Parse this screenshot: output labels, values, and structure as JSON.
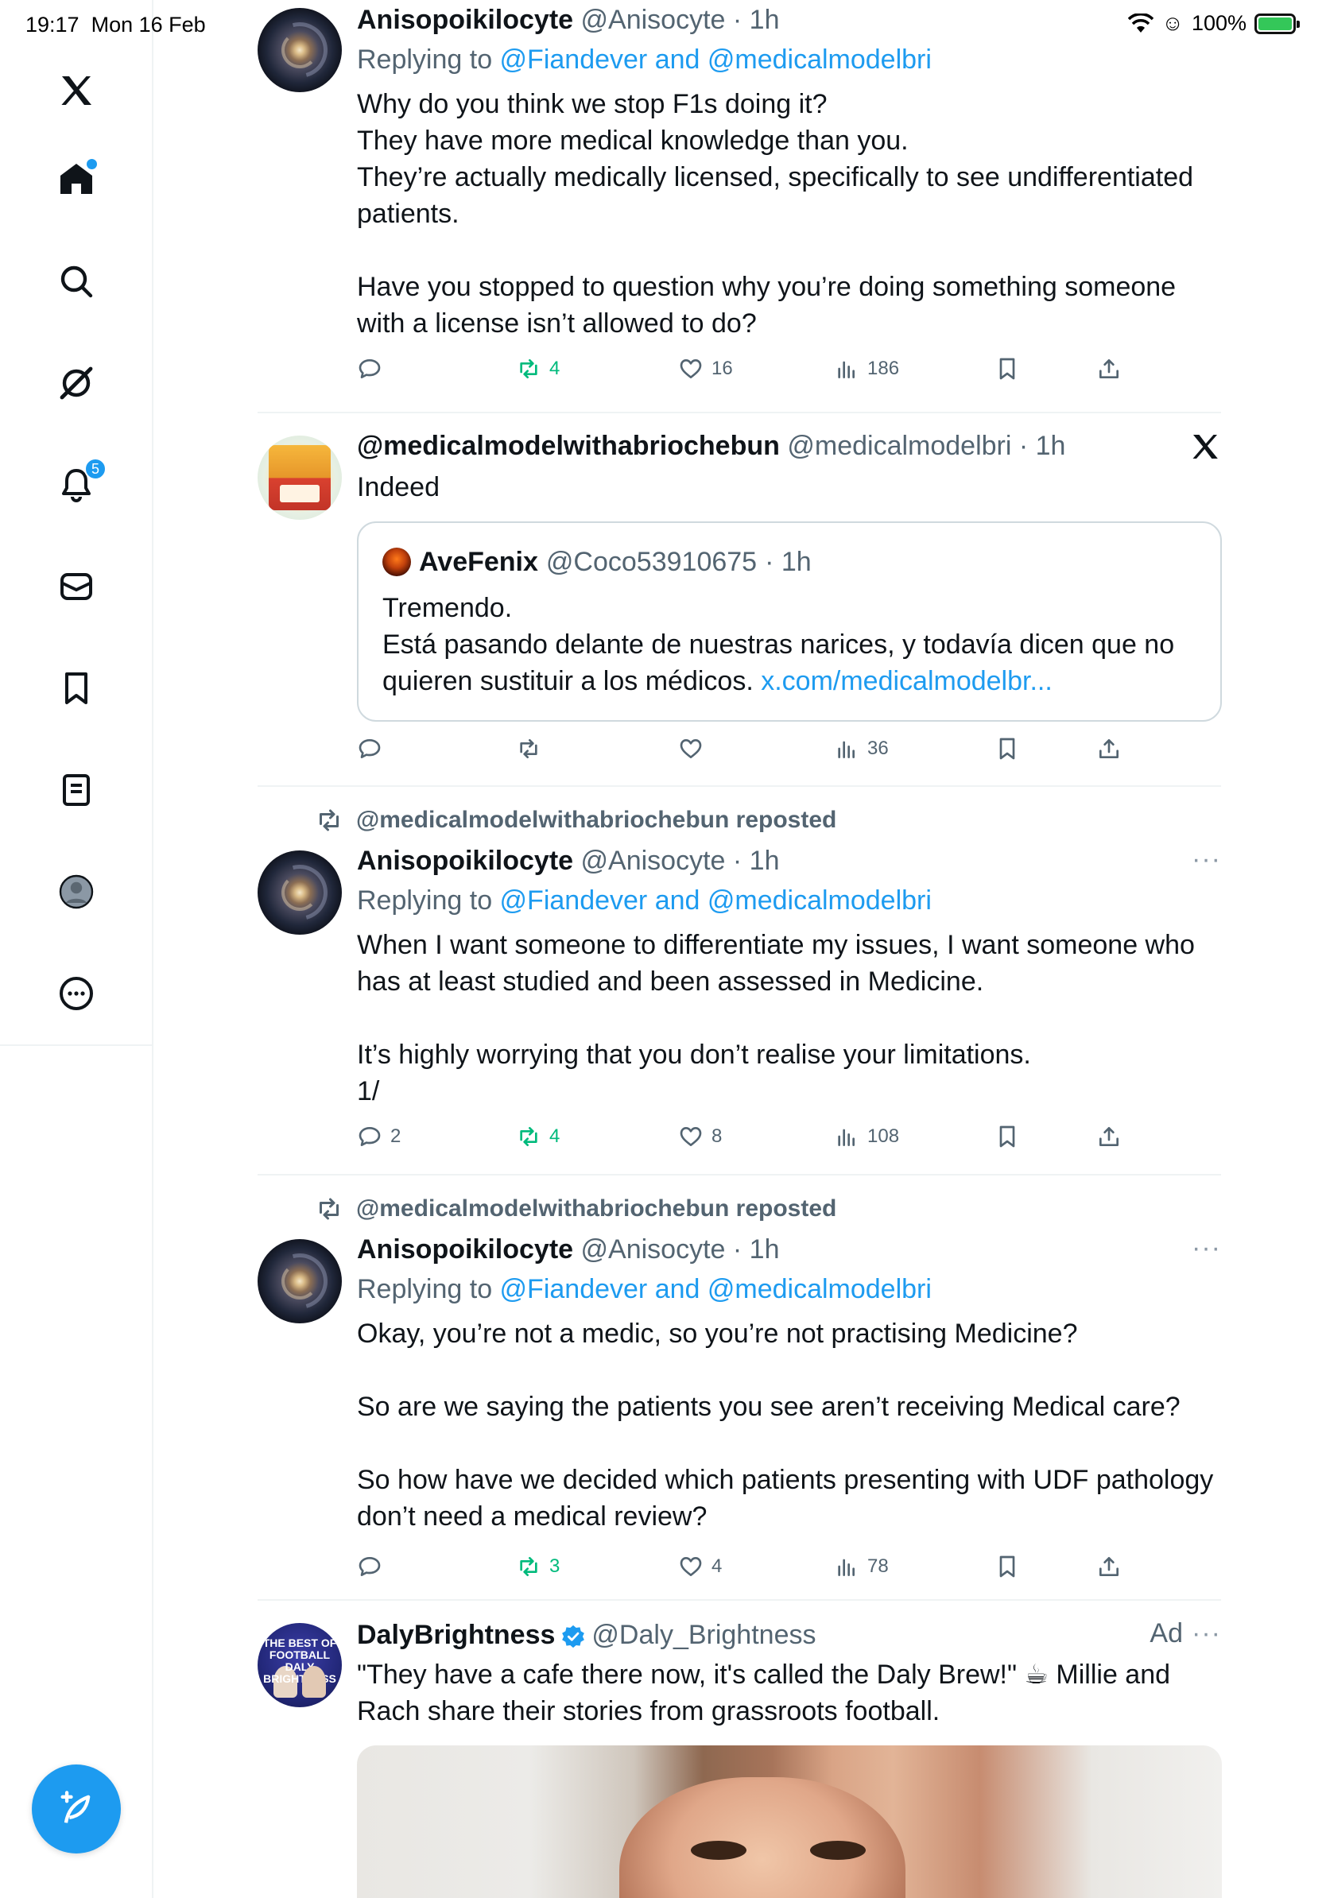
{
  "status_bar": {
    "time": "19:17",
    "date": "Mon 16 Feb",
    "battery": "100%"
  },
  "sidebar": {
    "notifications_badge": "5"
  },
  "tweets": [
    {
      "name": "Anisopoikilocyte",
      "handle": "@Anisocyte",
      "time": "· 1h",
      "replying_prefix": "Replying to ",
      "replying_to": "@Fiandever and @medicalmodelbri",
      "text": "Why do you think we stop F1s doing it?\nThey have more medical knowledge than you.\nThey’re actually medically licensed, specifically to see undifferentiated patients.\n\nHave you stopped to question why you’re doing something someone with a license isn’t allowed to do?",
      "replies": "",
      "reposts": "4",
      "likes": "16",
      "views": "186"
    },
    {
      "name": "@medicalmodelwithabriochebun",
      "handle": "@medicalmodelbri",
      "time": "· 1h",
      "text": "Indeed",
      "quote": {
        "name": "AveFenix",
        "handle": "@Coco53910675",
        "time": "· 1h",
        "text": "Tremendo.\nEstá pasando delante de nuestras narices, y todavía dicen que no quieren sustituir a los médicos. ",
        "link": "x.com/medicalmodelbr..."
      },
      "replies": "",
      "reposts": "",
      "likes": "",
      "views": "36"
    },
    {
      "repost_label": "@medicalmodelwithabriochebun reposted",
      "name": "Anisopoikilocyte",
      "handle": "@Anisocyte",
      "time": "· 1h",
      "replying_prefix": "Replying to ",
      "replying_to": "@Fiandever and @medicalmodelbri",
      "text": "When I want someone to differentiate my issues, I want someone who has at least studied and been assessed in Medicine.\n\nIt’s highly worrying that you don’t realise your limitations.\n1/",
      "replies": "2",
      "reposts": "4",
      "likes": "8",
      "views": "108"
    },
    {
      "repost_label": "@medicalmodelwithabriochebun reposted",
      "name": "Anisopoikilocyte",
      "handle": "@Anisocyte",
      "time": "· 1h",
      "replying_prefix": "Replying to ",
      "replying_to": "@Fiandever and @medicalmodelbri",
      "text": "Okay, you’re not a medic, so you’re not practising Medicine?\n\nSo are we saying the patients you see aren’t receiving Medical care?\n\nSo how have we decided which patients presenting with UDF pathology don’t need a medical review?",
      "replies": "",
      "reposts": "3",
      "likes": "4",
      "views": "78"
    },
    {
      "name": "DalyBrightness",
      "handle": "@Daly_Brightness",
      "ad_label": "Ad",
      "avatar_text": "THE BEST OF FOOTBALL DALY BRIGHTNESS",
      "text": "\"They have a cafe there now, it's called the Daly Brew!\" ☕ Millie and Rach share their stories from grassroots football."
    }
  ],
  "colors": {
    "accent": "#1d9bf0",
    "repost_green": "#00ba7c",
    "muted": "#536471",
    "divider": "#eff3f4"
  },
  "icons": [
    "x-logo-icon",
    "home-icon",
    "search-icon",
    "grok-icon",
    "bell-icon",
    "mail-icon",
    "bookmark-icon",
    "lists-icon",
    "profile-icon",
    "more-icon",
    "compose-icon",
    "reply-icon",
    "repost-icon",
    "like-icon",
    "views-icon",
    "share-icon",
    "verified-icon",
    "wifi-icon",
    "battery-icon"
  ]
}
